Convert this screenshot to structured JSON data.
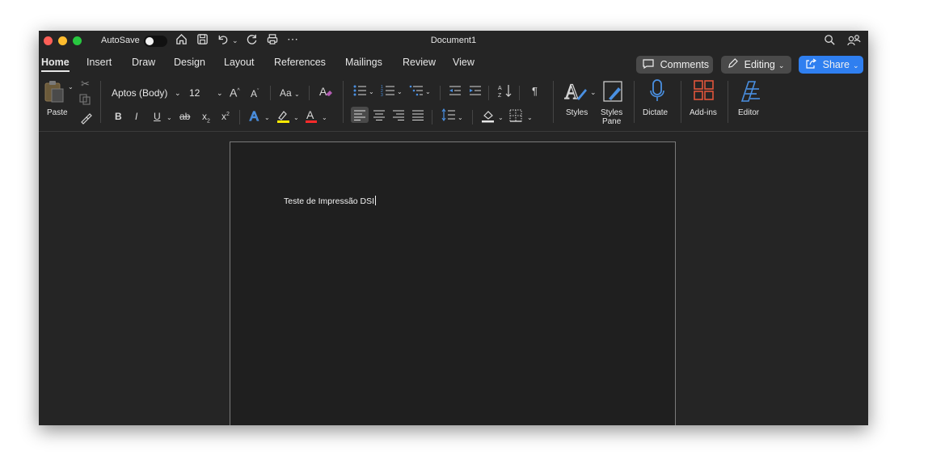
{
  "titlebar": {
    "autosave_label": "AutoSave",
    "document_title": "Document1",
    "icons": [
      "home-icon",
      "save-icon",
      "undo-icon",
      "redo-icon",
      "print-icon",
      "more-icon",
      "search-icon",
      "collaborate-icon"
    ]
  },
  "tabs": [
    "Home",
    "Insert",
    "Draw",
    "Design",
    "Layout",
    "References",
    "Mailings",
    "Review",
    "View"
  ],
  "active_tab": "Home",
  "actions": {
    "comments": "Comments",
    "editing": "Editing",
    "share": "Share"
  },
  "ribbon": {
    "paste_label": "Paste",
    "font_name": "Aptos (Body)",
    "font_size": "12",
    "styles_label": "Styles",
    "styles_pane_line1": "Styles",
    "styles_pane_line2": "Pane",
    "dictate_label": "Dictate",
    "addins_label": "Add-ins",
    "editor_label": "Editor"
  },
  "document": {
    "text": "Teste de Impressão DSI"
  },
  "colors": {
    "background": "#252525",
    "share_blue": "#2f7ff0",
    "highlight_yellow": "#ffeb00",
    "font_color_red": "#ff2b2b",
    "dictate_blue": "#4a90e2",
    "addins_red": "#e0553b"
  }
}
